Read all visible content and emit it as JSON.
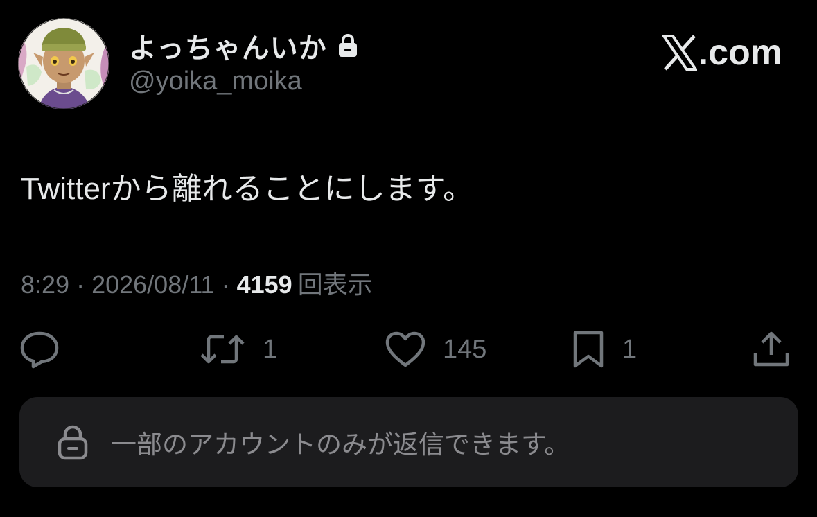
{
  "author": {
    "display_name": "よっちゃんいか",
    "handle": "@yoika_moika",
    "protected": true,
    "avatar": "avatar-illustration"
  },
  "brand": {
    "logo_icon": "x-logo-icon",
    "suffix": ".com"
  },
  "tweet": {
    "text": "Twitterから離れることにします。",
    "time": "8:29",
    "separator": "·",
    "date": "2026/08/11",
    "views_count": "4159",
    "views_label": "回表示"
  },
  "actions": {
    "reply": {
      "icon": "reply-icon",
      "count": ""
    },
    "retweet": {
      "icon": "retweet-icon",
      "count": "1"
    },
    "like": {
      "icon": "heart-icon",
      "count": "145"
    },
    "bookmark": {
      "icon": "bookmark-icon",
      "count": "1"
    },
    "share": {
      "icon": "share-icon"
    }
  },
  "reply_restriction": {
    "icon": "lock-icon",
    "text": "一部のアカウントのみが返信できます。"
  },
  "colors": {
    "background": "#000000",
    "text_primary": "#e7e9ea",
    "text_secondary": "#71767b",
    "notice_background": "#1c1c1e"
  }
}
